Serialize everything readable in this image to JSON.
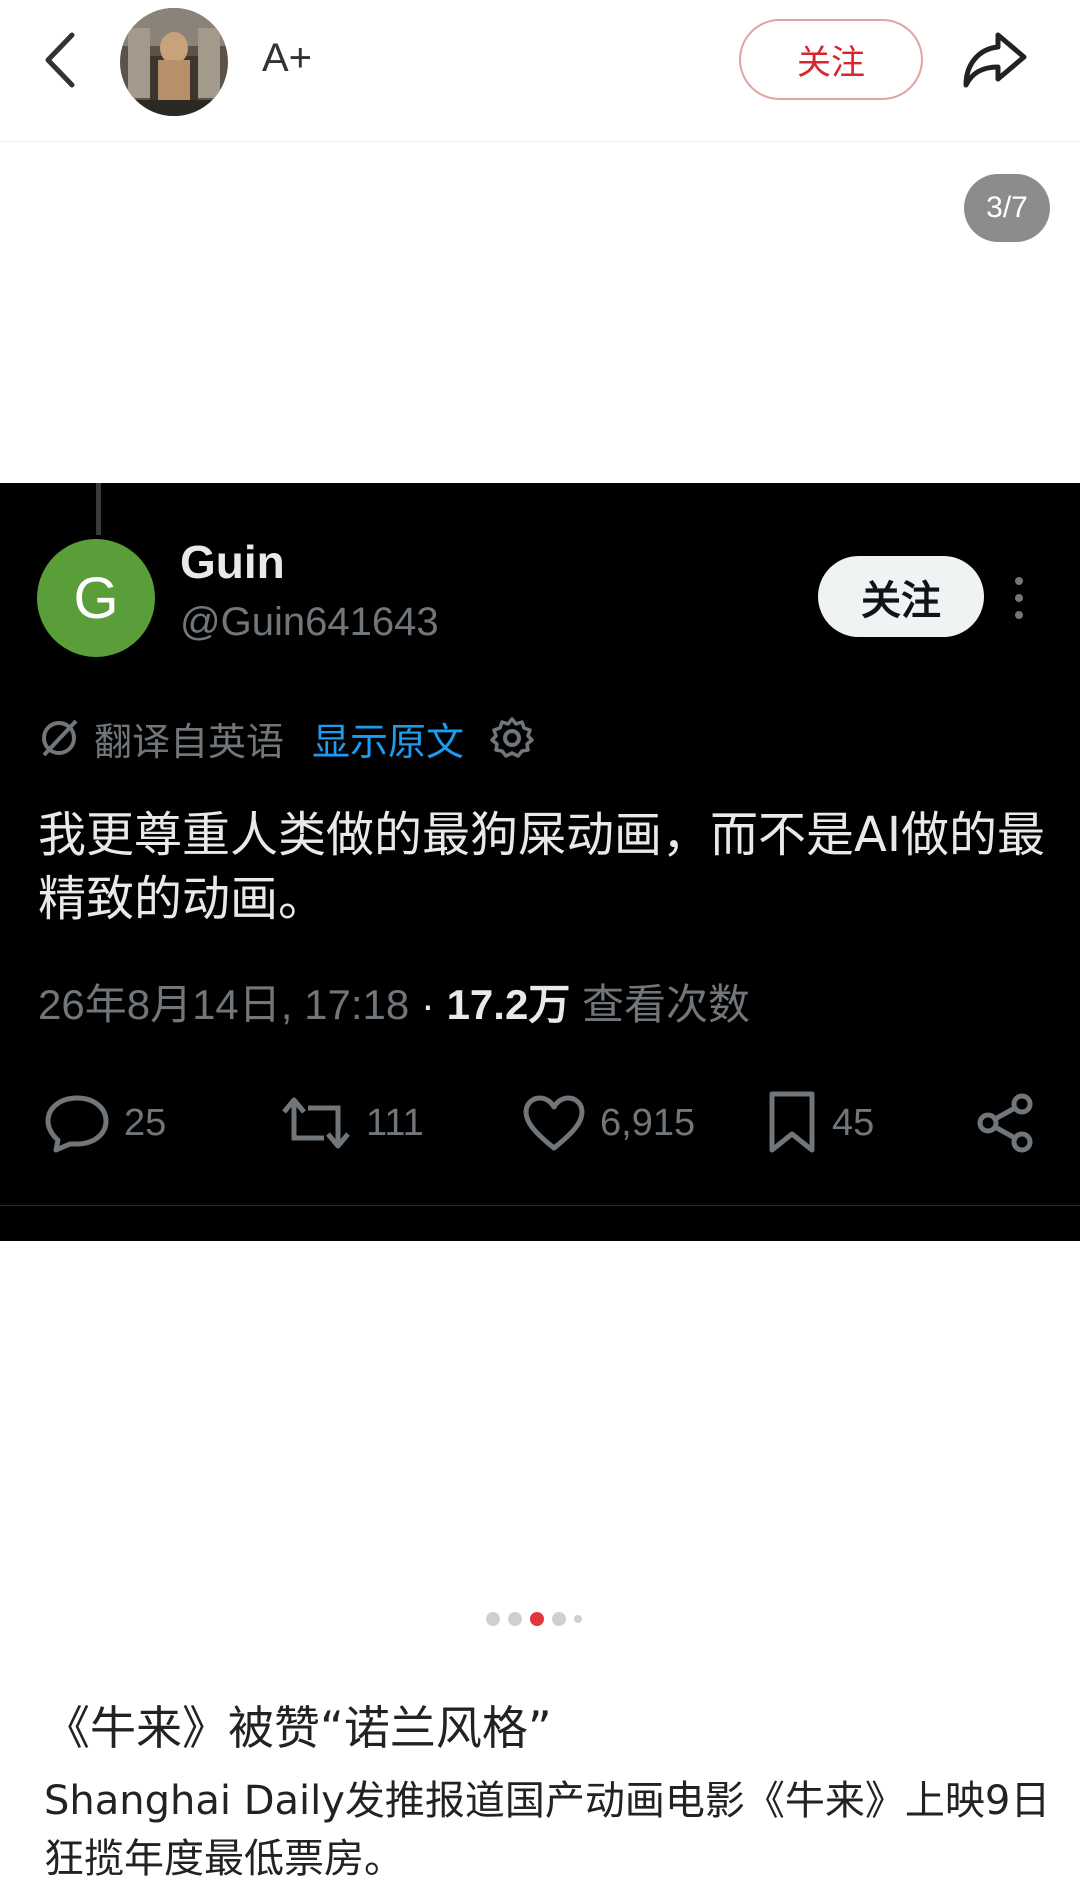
{
  "topbar": {
    "back_icon": "chevron-left-icon",
    "avatar_alt": "avatar",
    "font_size_label": "A+",
    "follow_label": "关注",
    "share_icon": "share-arrow-icon"
  },
  "gallery": {
    "counter": "3/7",
    "dots": {
      "total": 5,
      "active_index": 2
    }
  },
  "tweet": {
    "avatar_letter": "G",
    "avatar_color": "#5a9e3a",
    "name": "Guin",
    "handle": "@Guin641643",
    "follow_label": "关注",
    "translate_label": "翻译自英语",
    "show_original_label": "显示原文",
    "body": "我更尊重人类做的最狗屎动画，而不是AI做的最精致的动画。",
    "timestamp": "26年8月14日, 17:18",
    "separator": "·",
    "views_count": "17.2万",
    "views_label": "查看次数",
    "actions": {
      "replies": "25",
      "reposts": "111",
      "likes": "6,915",
      "bookmarks": "45"
    },
    "accent_color": "#1d9bf0"
  },
  "article": {
    "headline": "《牛来》被赞“诺兰风格”",
    "summary": "Shanghai Daily发推报道国产动画电影《牛来》上映9日狂揽年度最低票房。"
  }
}
